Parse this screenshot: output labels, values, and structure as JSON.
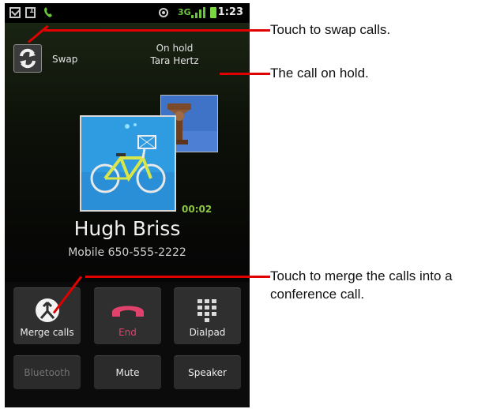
{
  "status_bar": {
    "time": "1:23",
    "data_indicator": "3G",
    "icons": [
      "gmail-icon",
      "calendar-icon",
      "phone-icon",
      "gps-icon",
      "data-icon",
      "signal-icon",
      "battery-icon"
    ]
  },
  "call": {
    "swap_label": "Swap",
    "hold_status": "On hold",
    "hold_name": "Tara Hertz",
    "timer": "00:02",
    "caller_name": "Hugh Briss",
    "caller_number": "Mobile 650-555-2222"
  },
  "buttons": {
    "merge": "Merge calls",
    "end": "End",
    "dialpad": "Dialpad",
    "bluetooth": "Bluetooth",
    "mute": "Mute",
    "speaker": "Speaker"
  },
  "callouts": {
    "swap": "Touch to swap calls.",
    "hold": "The call on hold.",
    "merge_line1": "Touch to merge the calls into a",
    "merge_line2": "conference call."
  },
  "colors": {
    "timer": "#8cc63f",
    "end_red": "#e0426b",
    "callout_line": "#e00000"
  }
}
